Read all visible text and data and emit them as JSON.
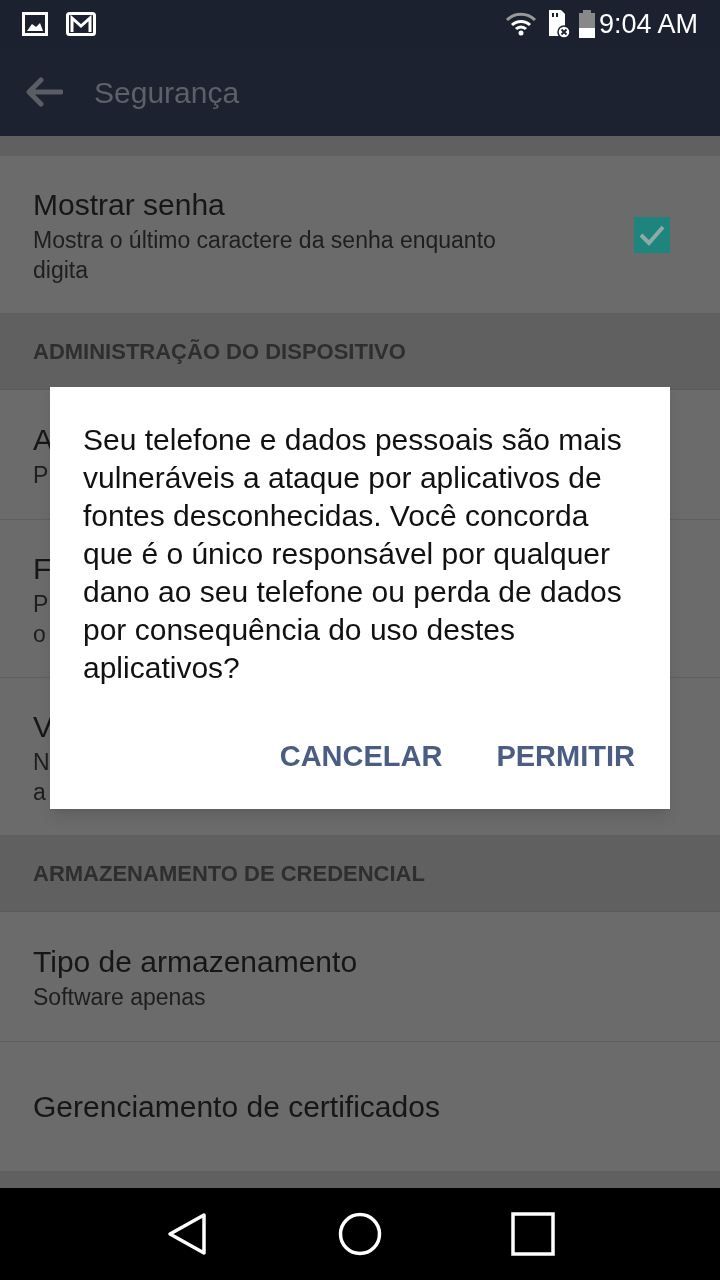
{
  "status_bar": {
    "time": "9:04 AM"
  },
  "toolbar": {
    "title": "Segurança"
  },
  "list": [
    {
      "kind": "checkbox",
      "title": "Mostrar senha",
      "summary_lines": [
        "Mostra o último caractere da senha enquanto",
        "digita"
      ],
      "checked": true
    },
    {
      "kind": "header",
      "title": "ADMINISTRAÇÃO DO DISPOSITIVO"
    },
    {
      "kind": "setting",
      "title": "A",
      "summary_lines": [
        "P"
      ]
    },
    {
      "kind": "setting",
      "title": "F",
      "summary_lines": [
        "P",
        "o"
      ]
    },
    {
      "kind": "setting",
      "title": "V",
      "summary_lines": [
        "N",
        "a"
      ]
    },
    {
      "kind": "header",
      "title": "ARMAZENAMENTO DE CREDENCIAL"
    },
    {
      "kind": "setting",
      "title": "Tipo de armazenamento",
      "summary_lines": [
        "Software apenas"
      ]
    },
    {
      "kind": "setting",
      "title": "Gerenciamento de certificados"
    }
  ],
  "dialog": {
    "message": "Seu telefone e dados pessoais são mais vulneráveis a ataque por aplicativos de fontes desconhecidas. Você concorda que é o único responsável por qualquer dano ao seu telefone ou perda de dados por consequência do uso destes aplicativos?",
    "buttons": [
      "CANCELAR",
      "PERMITIR"
    ]
  }
}
